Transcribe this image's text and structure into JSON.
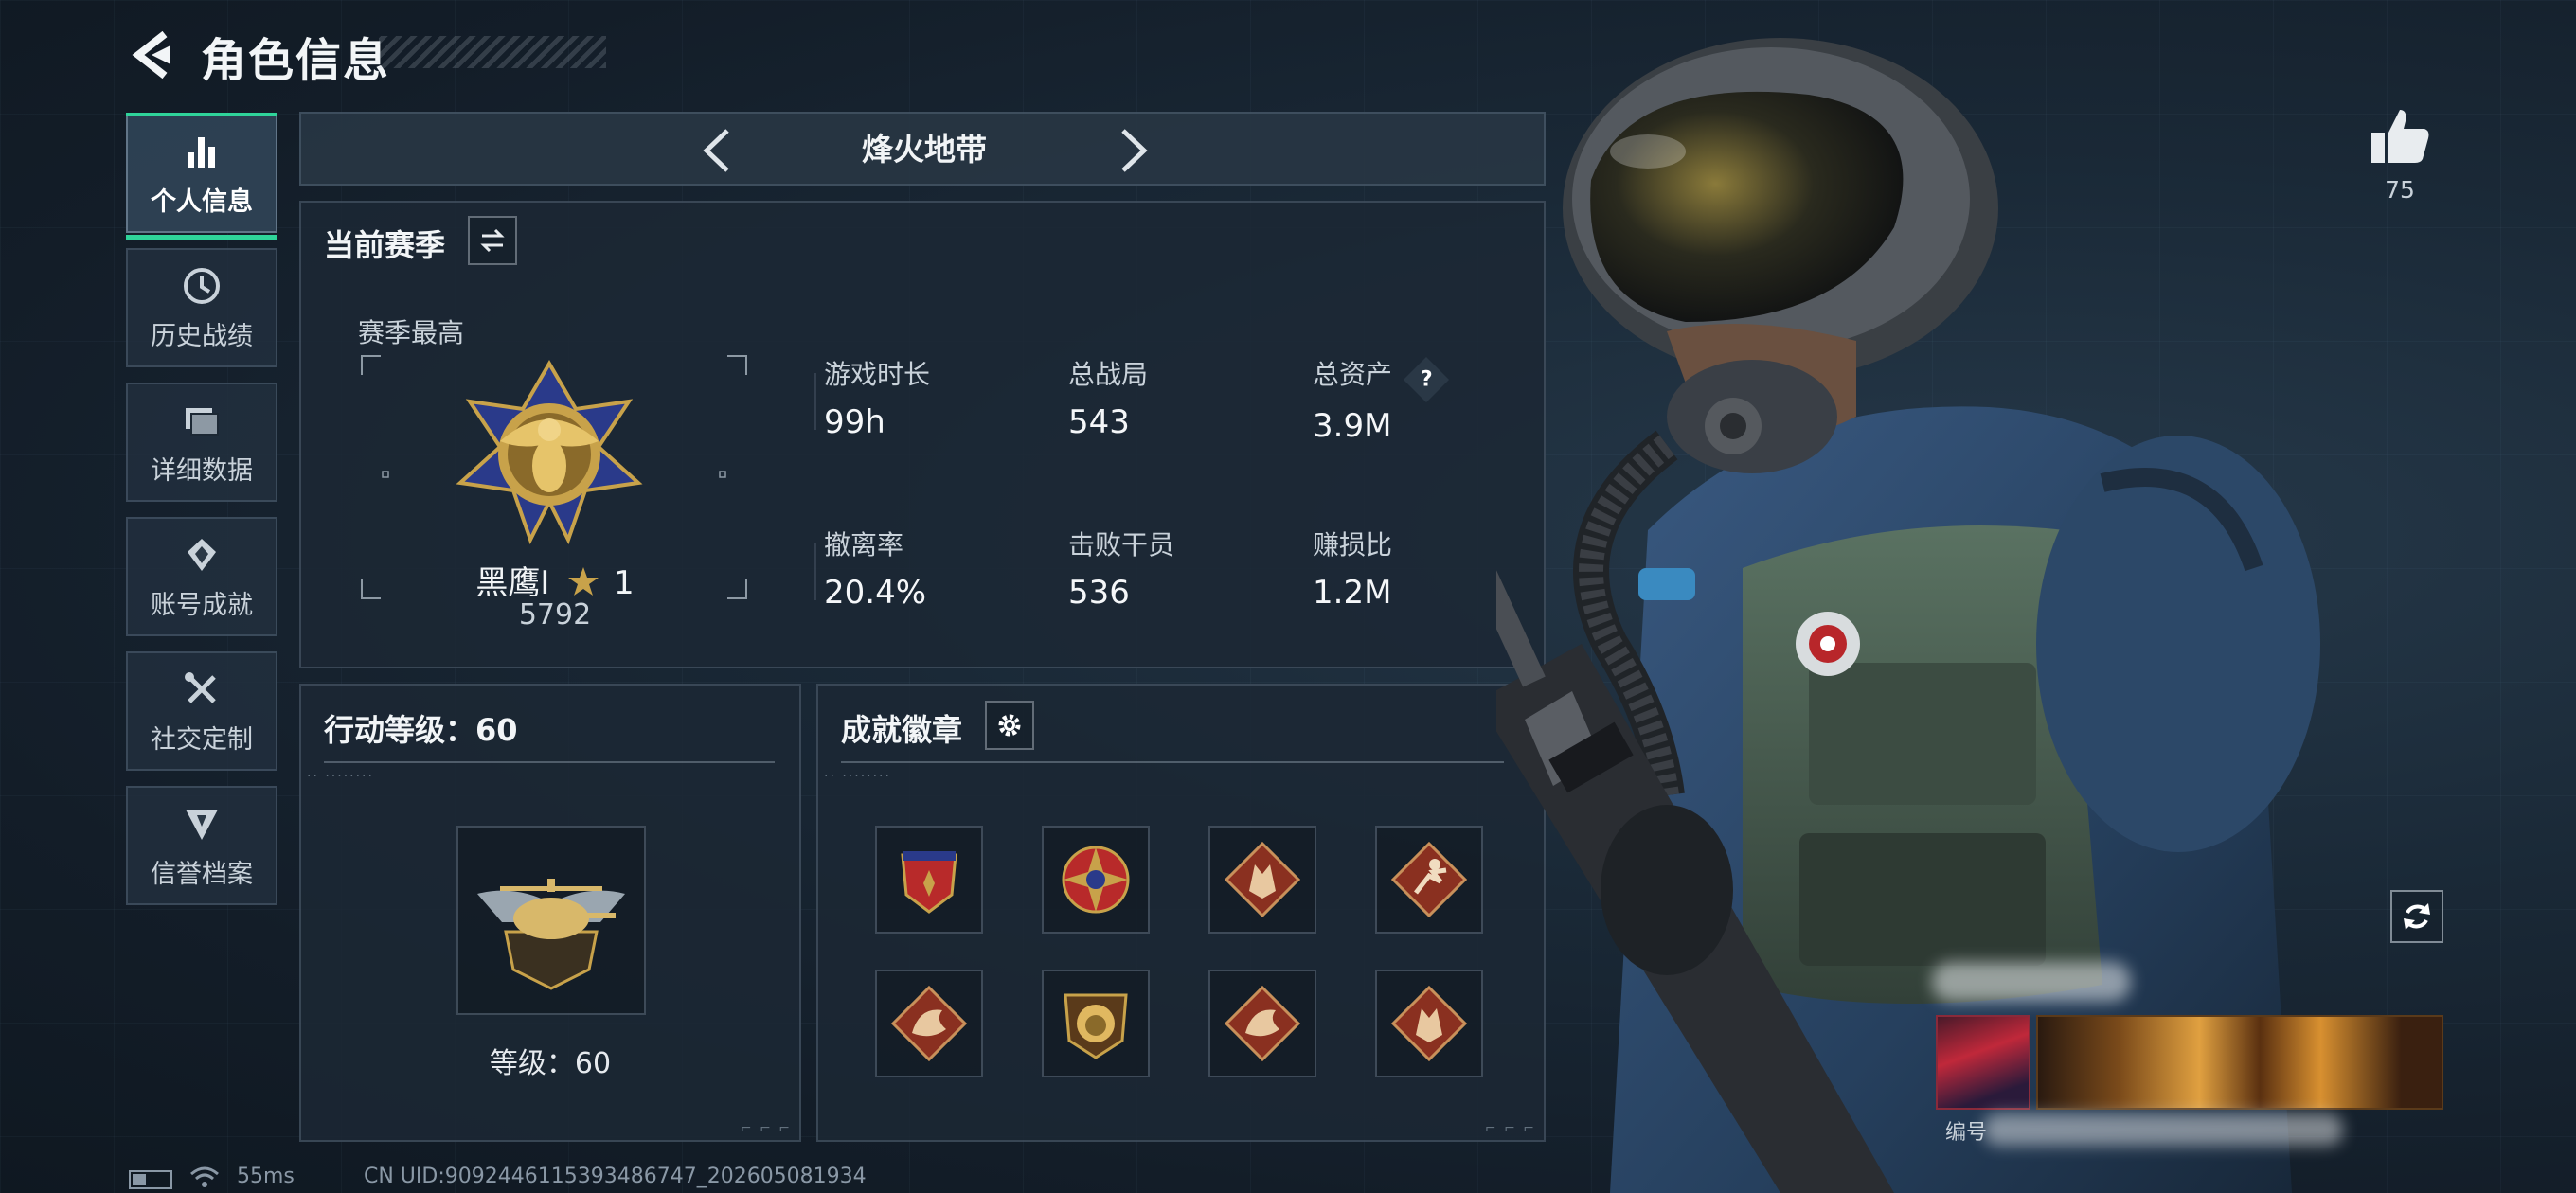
{
  "header": {
    "title": "角色信息"
  },
  "sidebar": {
    "items": [
      {
        "label": "个人信息",
        "icon": "bar-chart-icon",
        "active": true
      },
      {
        "label": "历史战绩",
        "icon": "history-clock-icon",
        "active": false
      },
      {
        "label": "详细数据",
        "icon": "folder-icon",
        "active": false
      },
      {
        "label": "账号成就",
        "icon": "achievement-icon",
        "active": false
      },
      {
        "label": "社交定制",
        "icon": "tools-icon",
        "active": false
      },
      {
        "label": "信誉档案",
        "icon": "credit-shield-icon",
        "active": false
      }
    ]
  },
  "mode": {
    "title": "烽火地带"
  },
  "season": {
    "title": "当前赛季",
    "best_label": "赛季最高",
    "rank_name": "黑鹰I",
    "rank_stars": "1",
    "rank_score": "5792",
    "stats": [
      {
        "label": "游戏时长",
        "value": "99h"
      },
      {
        "label": "总战局",
        "value": "543"
      },
      {
        "label": "总资产",
        "value": "3.9M",
        "help": "?"
      },
      {
        "label": "撤离率",
        "value": "20.4%"
      },
      {
        "label": "击败干员",
        "value": "536"
      },
      {
        "label": "赚损比",
        "value": "1.2M"
      }
    ]
  },
  "level": {
    "title": "行动等级：60",
    "text": "等级：60"
  },
  "achievements": {
    "title": "成就徽章",
    "badges": [
      "eagle-shield-badge",
      "star-compass-badge",
      "wolf-badge",
      "runner-badge",
      "dragon-badge",
      "lion-badge",
      "dragon-badge",
      "wolf-badge"
    ]
  },
  "right": {
    "likes": "75",
    "card_id_label": "编号"
  },
  "footer": {
    "ping": "55ms",
    "uid": "CN UID:9092446115393486747_202605081934"
  },
  "colors": {
    "accent": "#2fd49a",
    "panel": "#1c2834",
    "gold": "#c8a24a"
  }
}
